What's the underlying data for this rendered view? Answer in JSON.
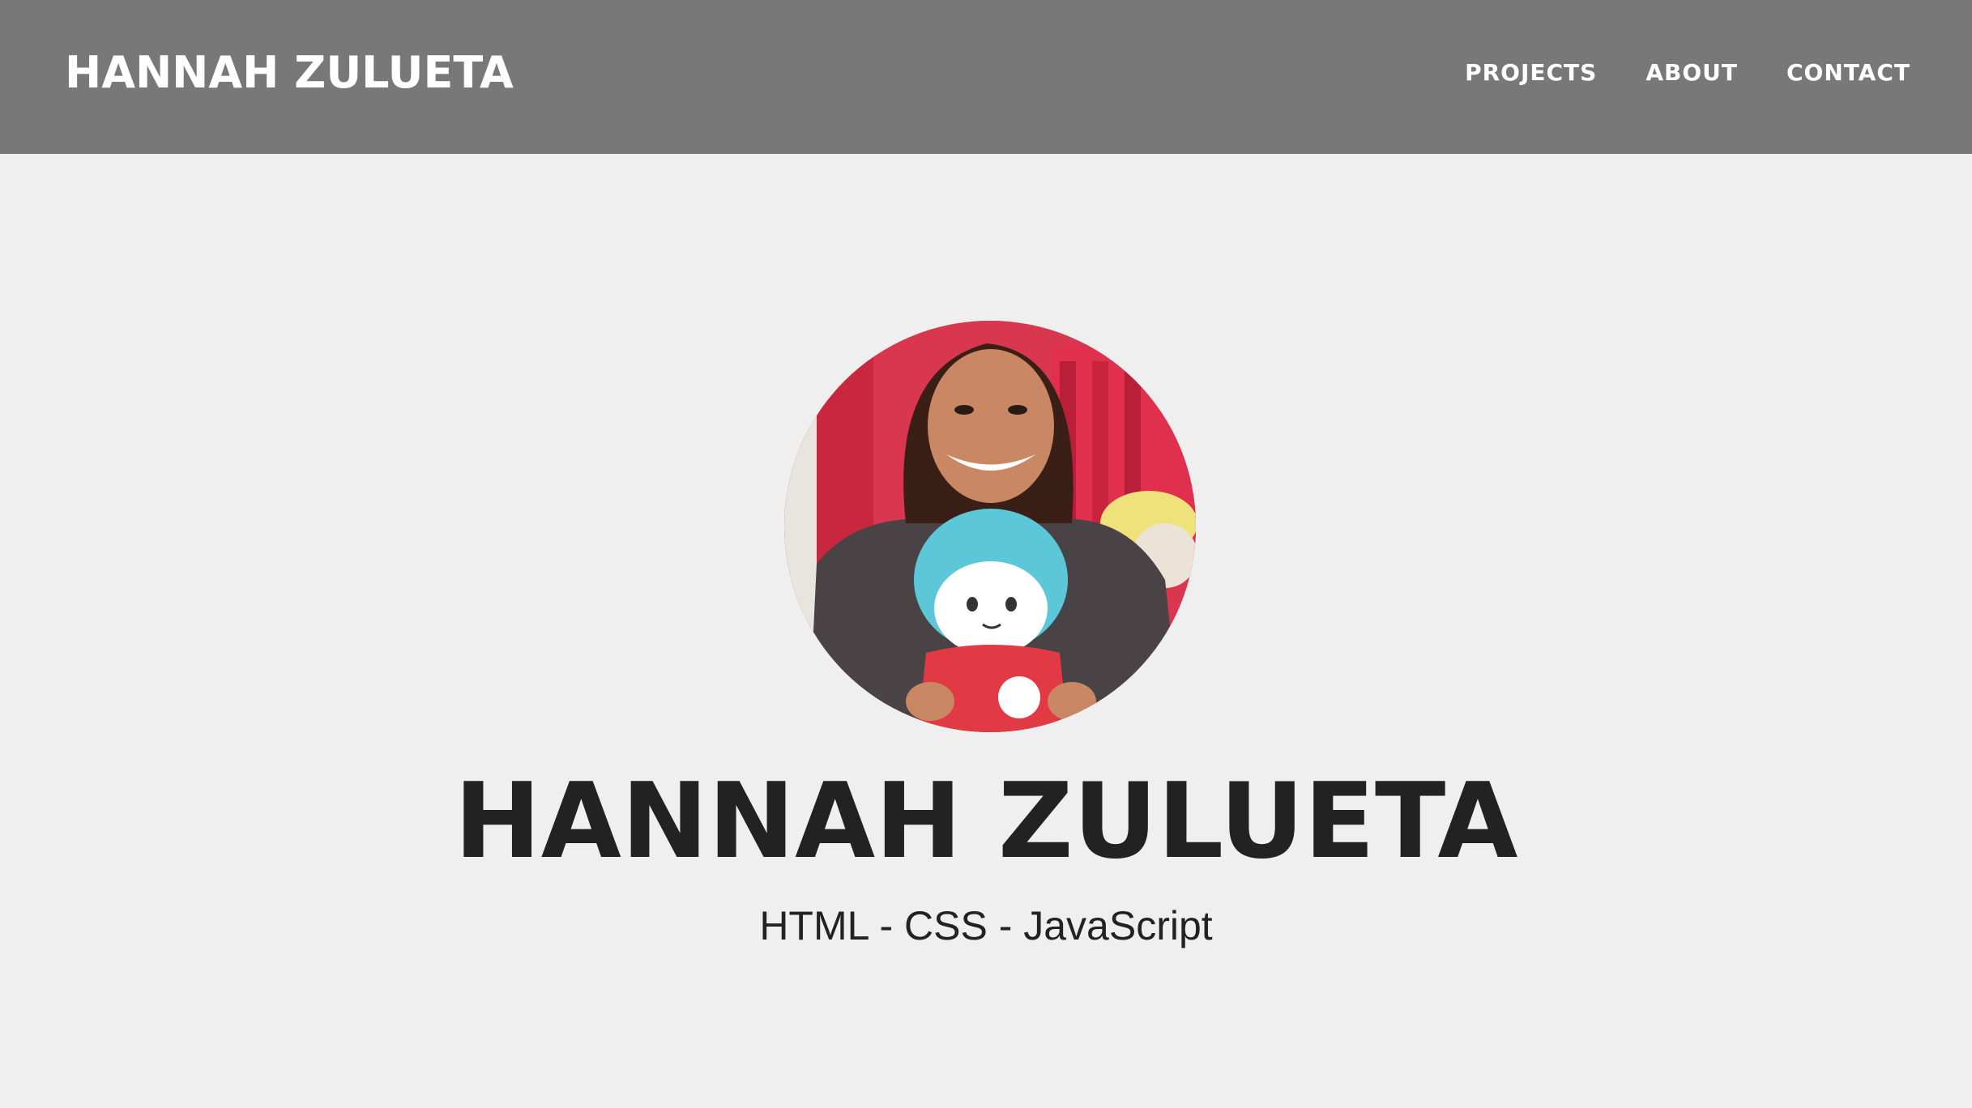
{
  "header": {
    "brand": "HANNAH ZULUETA",
    "nav": [
      {
        "label": "PROJECTS"
      },
      {
        "label": "ABOUT"
      },
      {
        "label": "CONTACT"
      }
    ]
  },
  "hero": {
    "title": "HANNAH ZULUETA",
    "subtitle": "HTML - CSS - JavaScript",
    "avatar_icon": "profile-photo"
  },
  "colors": {
    "navbar": "#787878",
    "background": "#efefef",
    "text": "#222222",
    "nav_text": "#ffffff"
  }
}
